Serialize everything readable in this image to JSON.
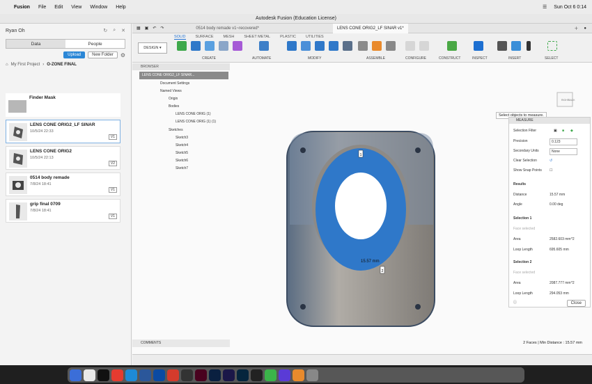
{
  "menubar": {
    "app": "Fusion",
    "items": [
      "File",
      "Edit",
      "View",
      "Window",
      "Help"
    ],
    "clock": "Sun Oct 6  0:14"
  },
  "window": {
    "title": "Autodesk Fusion (Education License)"
  },
  "datapanel": {
    "user": "Ryan Oh",
    "tabs": [
      "Data",
      "People"
    ],
    "upload": "Upload",
    "new_folder": "New Folder",
    "breadcrumb": {
      "root": "My First Project",
      "current": "O-ZONE FINAL"
    },
    "items": [
      {
        "name": "Finder Mask",
        "date": "",
        "version": ""
      },
      {
        "name": "LENS CONE ORIG2_LF SINAR",
        "date": "10/5/24 22:33",
        "version": "V1"
      },
      {
        "name": "LENS CONE ORIG2",
        "date": "10/5/24 22:13",
        "version": "V2"
      },
      {
        "name": "0514 body remade",
        "date": "7/8/24 18:41",
        "version": "V1"
      },
      {
        "name": "grip final 0709",
        "date": "7/8/24 18:41",
        "version": "V1"
      }
    ]
  },
  "tabs": [
    "0514 body remade v1~recovered*",
    "LENS CONE ORIG2_LF SINAR v1*"
  ],
  "ribbon": {
    "workspace": "DESIGN",
    "tabs": [
      "SOLID",
      "SURFACE",
      "MESH",
      "SHEET METAL",
      "PLASTIC",
      "UTILITIES"
    ],
    "groups": [
      "CREATE",
      "AUTOMATE",
      "MODIFY",
      "ASSEMBLE",
      "CONFIGURE",
      "CONSTRUCT",
      "INSPECT",
      "INSERT",
      "SELECT"
    ]
  },
  "browser": {
    "title": "BROWSER",
    "root": "LENS CONE ORIG2_LF SINAR...",
    "rows": [
      "Document Settings",
      "Named Views",
      "Origin",
      "Bodies",
      "LENS CONE ORIG (1)",
      "LENS CONE ORIG (1) (1)",
      "Sketches",
      "Sketch3",
      "Sketch4",
      "Sketch5",
      "Sketch6",
      "Sketch7"
    ]
  },
  "tooltip": "Select objects to measure.",
  "measure": {
    "title": "MEASURE",
    "selection_filter": "Selection Filter",
    "precision_label": "Precision",
    "precision": "0.123",
    "secondary_label": "Secondary Units",
    "secondary": "None",
    "clear": "Clear Selection",
    "snap": "Show Snap Points",
    "results": "Results",
    "distance_label": "Distance",
    "distance": "15.57 mm",
    "angle_label": "Angle",
    "angle": "0.00 deg",
    "sel1": "Selection 1",
    "sel1_face": "Face selected",
    "area_label": "Area",
    "sel1_area": "2582.603 mm^2",
    "loop_label": "Loop Length",
    "sel1_loop": "695.605 mm",
    "sel2": "Selection 2",
    "sel2_face": "Face selected",
    "sel2_area": "2087.777 mm^2",
    "sel2_loop": "294.053 mm",
    "close": "Close"
  },
  "viewport": {
    "dim_label": "15.57 mm",
    "marker1": "1",
    "marker2": "2",
    "viewcube_front": "RIGHT",
    "viewcube_back": "BACK"
  },
  "comments": "COMMENTS",
  "status": "2 Faces | Min Distance : 15.57 mm",
  "colors": {
    "accent": "#1d6fd1",
    "face_blue": "#2f78c9",
    "metal": "#8d8a86"
  }
}
